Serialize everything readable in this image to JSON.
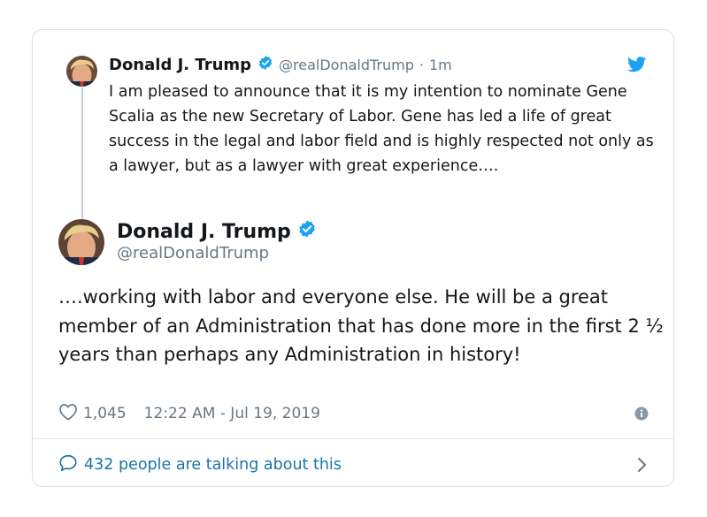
{
  "parent_tweet": {
    "name": "Donald J. Trump",
    "handle": "@realDonaldTrump",
    "separator": "·",
    "time": "1m",
    "text": "I am pleased to announce that it is my intention to nominate Gene Scalia as the new Secretary of Labor. Gene has led a life of great success in the legal and labor field and is highly respected not only as a lawyer, but as a lawyer with great experience….",
    "verified_icon": "verified-badge-icon",
    "brand_icon": "twitter-bird-icon"
  },
  "main_tweet": {
    "name": "Donald J. Trump",
    "handle": "@realDonaldTrump",
    "verified_icon": "verified-badge-icon",
    "text": "….working with labor and everyone else. He will be a great member of an Administration that has done more in the first 2 ½ years than perhaps any Administration in history!",
    "likes": "1,045",
    "timestamp": "12:22 AM - Jul 19, 2019",
    "info_icon": "info-icon"
  },
  "footer": {
    "conversation_text": "432 people are talking about this",
    "icon": "speech-bubble-icon",
    "chevron": "chevron-right-icon"
  },
  "colors": {
    "text": "#14171a",
    "secondary": "#657786",
    "link": "#1b74a8",
    "twitter_blue": "#1da1f2",
    "verified": "#1da1f2",
    "border": "#dce1e5"
  }
}
